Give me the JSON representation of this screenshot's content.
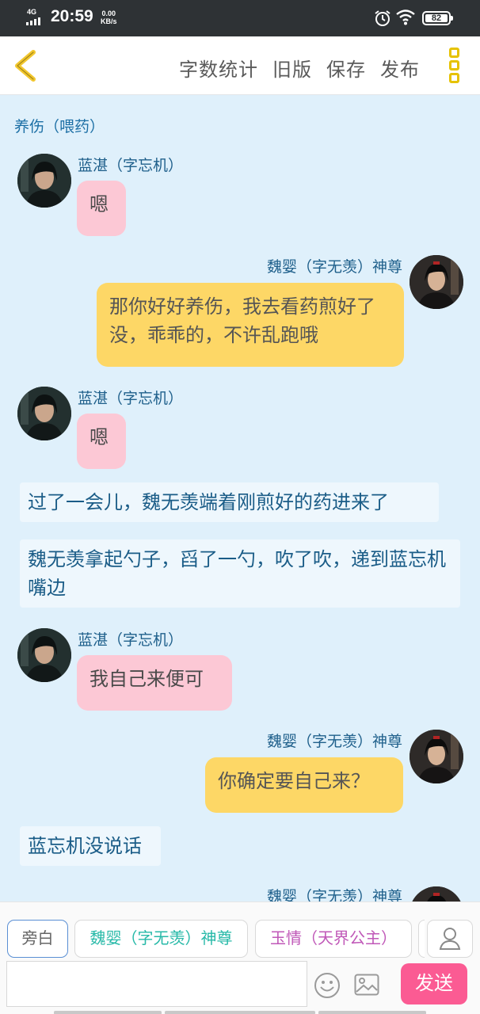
{
  "status_bar": {
    "network": "4G",
    "time": "20:59",
    "speed_value": "0.00",
    "speed_unit": "KB/s",
    "battery": "82"
  },
  "toolbar": {
    "word_count": "字数统计",
    "old_version": "旧版",
    "save": "保存",
    "publish": "发布"
  },
  "chat": {
    "scene_title": "养伤（喂药）",
    "messages": [
      {
        "speaker": "蓝湛（字忘机）",
        "text": "嗯"
      },
      {
        "speaker": "魏婴（字无羡）神尊",
        "text": "那你好好养伤，我去看药煎好了没，乖乖的，不许乱跑哦"
      },
      {
        "speaker": "蓝湛（字忘机）",
        "text": "嗯"
      },
      {
        "narration": "过了一会儿，魏无羡端着刚煎好的药进来了"
      },
      {
        "narration": "魏无羡拿起勺子，舀了一勺，吹了吹，递到蓝忘机嘴边"
      },
      {
        "speaker": "蓝湛（字忘机）",
        "text": "我自己来便可"
      },
      {
        "speaker": "魏婴（字无羡）神尊",
        "text": "你确定要自己来？"
      },
      {
        "narration": "蓝忘机没说话"
      },
      {
        "speaker": "魏婴（字无羡）神尊",
        "text": ""
      }
    ]
  },
  "bottom": {
    "roles": [
      "旁白",
      "魏婴（字无羡）神尊",
      "玉情（天界公主）"
    ],
    "send": "发送",
    "input_placeholder": ""
  },
  "colors": {
    "chat_bg": "#dff0fb",
    "pink_bubble": "#fcc8d5",
    "yellow_bubble": "#fdd766",
    "send_button": "#fb5b93",
    "menu_icon": "#e6c200"
  },
  "icons": [
    "back-chevron-icon",
    "more-menu-icon",
    "alarm-icon",
    "wifi-icon",
    "person-icon",
    "emoji-icon",
    "image-icon"
  ]
}
